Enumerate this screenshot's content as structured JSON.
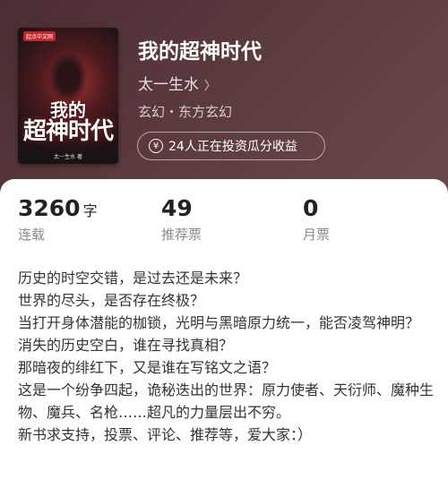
{
  "book": {
    "title": "我的超神时代",
    "author": "太一生水",
    "genre": "玄幻・东方玄幻",
    "invest_text": "24人正在投资瓜分收益"
  },
  "cover": {
    "publisher": "起点中文网",
    "title_line1": "我的",
    "title_line2": "超神时代",
    "author_small": "太一生水 著"
  },
  "stats": [
    {
      "value": "3260",
      "unit": "字",
      "label": "连载"
    },
    {
      "value": "49",
      "unit": "",
      "label": "推荐票"
    },
    {
      "value": "0",
      "unit": "",
      "label": "月票"
    }
  ],
  "description": [
    "历史的时空交错，是过去还是未来？",
    "世界的尽头，是否存在终极？",
    "当打开身体潜能的枷锁，光明与黑暗原力统一，能否凌驾神明？",
    "消失的历史空白，谁在寻找真相？",
    "那暗夜的绯红下，又是谁在写铭文之语？",
    "这是一个纷争四起，诡秘迭出的世界：原力使者、天衍师、魔种生物、魔兵、名枪……超凡的力量层出不穷。",
    "新书求支持，投票、评论、推荐等，爱大家：）"
  ],
  "colors": {
    "header_bg": "#5b3a3e",
    "label_gray": "#8a8a8a"
  },
  "icons": {
    "author_chevron": "chevron-right-icon",
    "invest": "yen-icon"
  }
}
